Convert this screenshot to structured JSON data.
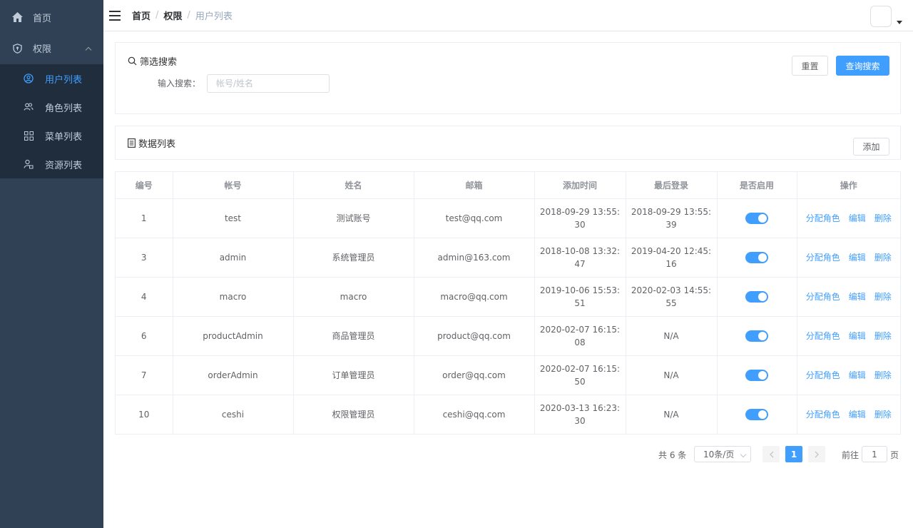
{
  "sidebar": {
    "home_label": "首页",
    "permission_label": "权限",
    "items": [
      {
        "label": "用户列表",
        "icon": "user-circle-icon",
        "active": true
      },
      {
        "label": "角色列表",
        "icon": "users-icon"
      },
      {
        "label": "菜单列表",
        "icon": "grid-icon"
      },
      {
        "label": "资源列表",
        "icon": "resource-icon"
      }
    ]
  },
  "navbar": {
    "breadcrumb": [
      "首页",
      "权限",
      "用户列表"
    ],
    "separator": "/"
  },
  "filter": {
    "title": "筛选搜索",
    "search_label": "输入搜索：",
    "search_placeholder": "帐号/姓名",
    "search_value": "",
    "reset_label": "重置",
    "query_label": "查询搜索"
  },
  "data_list": {
    "title": "数据列表",
    "add_label": "添加"
  },
  "table": {
    "headers": [
      "编号",
      "帐号",
      "姓名",
      "邮箱",
      "添加时间",
      "最后登录",
      "是否启用",
      "操作"
    ],
    "ops": [
      "分配角色",
      "编辑",
      "删除"
    ],
    "rows": [
      {
        "id": "1",
        "account": "test",
        "name": "测试账号",
        "email": "test@qq.com",
        "created": "2018-09-29 13:55:30",
        "last_login": "2018-09-29 13:55:39",
        "enabled": true
      },
      {
        "id": "3",
        "account": "admin",
        "name": "系统管理员",
        "email": "admin@163.com",
        "created": "2018-10-08 13:32:47",
        "last_login": "2019-04-20 12:45:16",
        "enabled": true
      },
      {
        "id": "4",
        "account": "macro",
        "name": "macro",
        "email": "macro@qq.com",
        "created": "2019-10-06 15:53:51",
        "last_login": "2020-02-03 14:55:55",
        "enabled": true
      },
      {
        "id": "6",
        "account": "productAdmin",
        "name": "商品管理员",
        "email": "product@qq.com",
        "created": "2020-02-07 16:15:08",
        "last_login": "N/A",
        "enabled": true
      },
      {
        "id": "7",
        "account": "orderAdmin",
        "name": "订单管理员",
        "email": "order@qq.com",
        "created": "2020-02-07 16:15:50",
        "last_login": "N/A",
        "enabled": true
      },
      {
        "id": "10",
        "account": "ceshi",
        "name": "权限管理员",
        "email": "ceshi@qq.com",
        "created": "2020-03-13 16:23:30",
        "last_login": "N/A",
        "enabled": true
      }
    ]
  },
  "pagination": {
    "total_text": "共 6 条",
    "page_size": "10条/页",
    "current_page": "1",
    "goto_label": "前往",
    "goto_value": "1",
    "page_suffix": "页"
  },
  "colors": {
    "sidebar_bg": "#304156",
    "submenu_bg": "#1f2d3d",
    "accent": "#409eff"
  }
}
